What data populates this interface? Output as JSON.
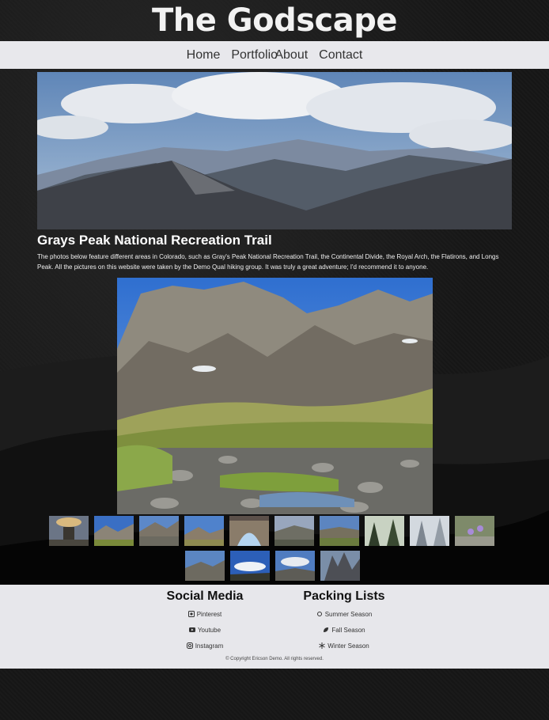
{
  "site": {
    "title": "The Godscape"
  },
  "nav": {
    "home": "Home",
    "portfolio": "Portfolio",
    "about": "About",
    "contact": "Contact"
  },
  "main": {
    "heading": "Grays Peak National Recreation Trail",
    "intro": "The photos below feature different areas in Colorado, such as Gray's Peak National Recreation Trail, the Continental Divide, the Royal Arch, the Flatirons, and Longs Peak. All the pictures on this website were taken by the Demo Qual hiking group. It was truly a great adventure; I'd recommend it to anyone."
  },
  "gallery": {
    "thumbnail_count_row1": 10,
    "thumbnail_count_row2": 4
  },
  "footer": {
    "social": {
      "heading": "Social Media",
      "items": [
        {
          "label": "Pinterest",
          "icon": "pinterest-icon"
        },
        {
          "label": "Youtube",
          "icon": "youtube-icon"
        },
        {
          "label": "Instagram",
          "icon": "instagram-icon"
        }
      ]
    },
    "packing": {
      "heading": "Packing Lists",
      "items": [
        {
          "label": "Summer Season",
          "icon": "sun-icon"
        },
        {
          "label": "Fall Season",
          "icon": "leaf-icon"
        },
        {
          "label": "Winter Season",
          "icon": "snowflake-icon"
        }
      ]
    },
    "copyright": "© Copyright Ericson Demo. All rights reserved."
  }
}
